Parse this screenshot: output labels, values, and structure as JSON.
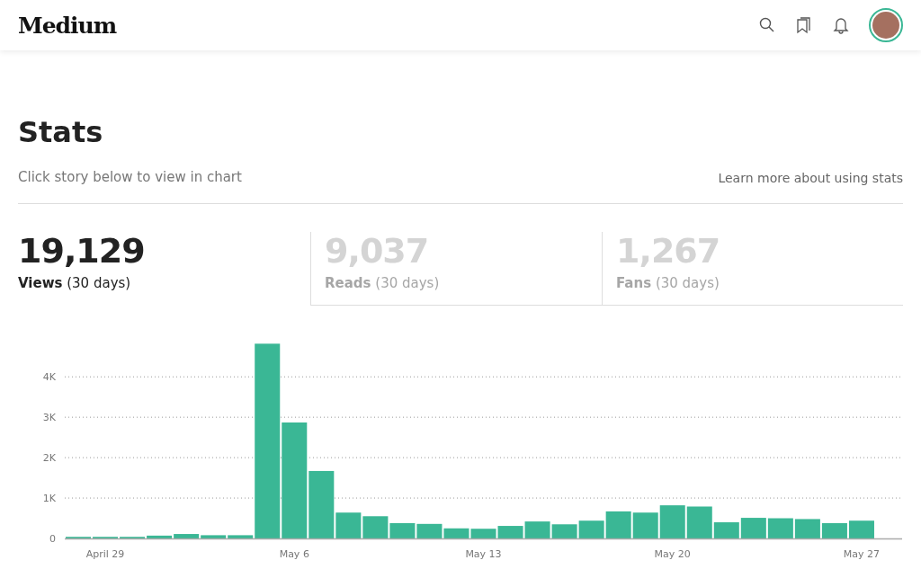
{
  "header": {
    "logo": "Medium"
  },
  "page": {
    "title": "Stats",
    "subtitle": "Click story below to view in chart",
    "help_link": "Learn more about using stats"
  },
  "metrics": [
    {
      "value": "19,129",
      "label": "**Views** (30 days)",
      "selected": true
    },
    {
      "value": "9,037",
      "label": "**Reads** (30 days)",
      "selected": false
    },
    {
      "value": "1,267",
      "label": "**Fans** (30 days)",
      "selected": false
    }
  ],
  "chart_data": {
    "type": "bar",
    "grid": true,
    "categories": [
      null,
      "April 29",
      null,
      null,
      null,
      null,
      null,
      null,
      "May 6",
      null,
      null,
      null,
      null,
      null,
      null,
      "May 13",
      null,
      null,
      null,
      null,
      null,
      null,
      "May 20",
      null,
      null,
      null,
      null,
      null,
      null,
      "May 27"
    ],
    "series": [
      {
        "color": "#3ab795",
        "values": [
          40,
          40,
          40,
          70,
          110,
          80,
          80,
          4820,
          2870,
          1670,
          640,
          550,
          380,
          360,
          250,
          240,
          310,
          420,
          350,
          440,
          670,
          640,
          820,
          790,
          400,
          510,
          500,
          480,
          380,
          440
        ]
      }
    ],
    "ylim": [
      0,
      4850
    ],
    "yticks": [
      {
        "value": 0,
        "label": "0"
      },
      {
        "value": 1000,
        "label": "1K"
      },
      {
        "value": 2000,
        "label": "2K"
      },
      {
        "value": 3000,
        "label": "3K"
      },
      {
        "value": 4000,
        "label": "4K"
      }
    ]
  }
}
